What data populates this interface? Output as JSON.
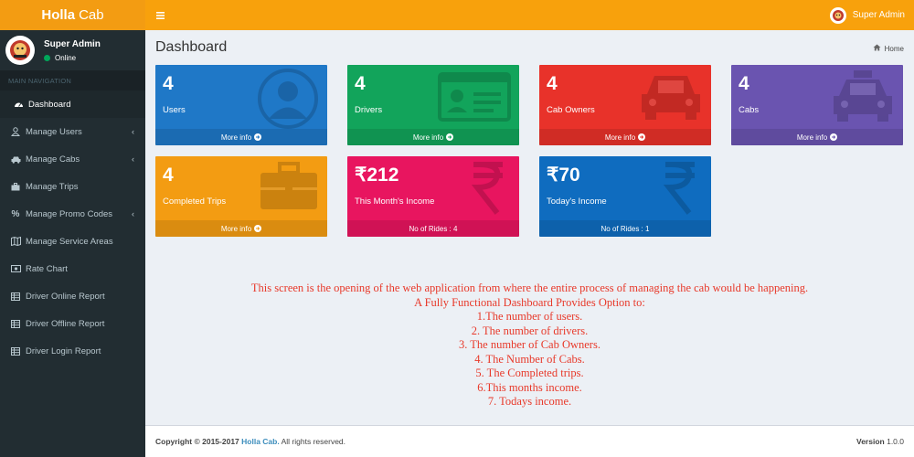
{
  "app": {
    "logo_bold": "Holla",
    "logo_rest": "Cab"
  },
  "topbar": {
    "user_name": "Super Admin"
  },
  "sidebar": {
    "user": {
      "name": "Super Admin",
      "status": "Online"
    },
    "header": "MAIN NAVIGATION",
    "items": [
      {
        "label": "Dashboard",
        "icon": "dashboard-icon"
      },
      {
        "label": "Manage Users",
        "icon": "user-icon",
        "chevron": "‹"
      },
      {
        "label": "Manage Cabs",
        "icon": "car-icon",
        "chevron": "‹"
      },
      {
        "label": "Manage Trips",
        "icon": "briefcase-icon"
      },
      {
        "label": "Manage Promo Codes",
        "icon": "percent-icon",
        "chevron": "‹"
      },
      {
        "label": "Manage Service Areas",
        "icon": "map-icon"
      },
      {
        "label": "Rate Chart",
        "icon": "money-icon"
      },
      {
        "label": "Driver Online Report",
        "icon": "table-icon"
      },
      {
        "label": "Driver Offline Report",
        "icon": "table-icon"
      },
      {
        "label": "Driver Login Report",
        "icon": "table-icon"
      }
    ]
  },
  "page": {
    "title": "Dashboard",
    "breadcrumb": "Home"
  },
  "boxes": [
    {
      "value": "4",
      "label": "Users",
      "footer": "More info"
    },
    {
      "value": "4",
      "label": "Drivers",
      "footer": "More info"
    },
    {
      "value": "4",
      "label": "Cab Owners",
      "footer": "More info"
    },
    {
      "value": "4",
      "label": "Cabs",
      "footer": "More info"
    },
    {
      "value": "4",
      "label": "Completed Trips",
      "footer": "More info"
    },
    {
      "value": "₹212",
      "label": "This Month's Income",
      "footer": "No of Rides : 4"
    },
    {
      "value": "₹70",
      "label": "Today's Income",
      "footer": "No of Rides : 1"
    }
  ],
  "description": [
    "This screen is the opening of the web application from where the entire process of managing the cab would be happening.",
    "A Fully Functional Dashboard Provides Option to:",
    "1.The number of users.",
    "2. The number of drivers.",
    "3. The number of Cab Owners.",
    "4. The Number of Cabs.",
    "5. The Completed trips.",
    "6.This months income.",
    "7. Todays income."
  ],
  "footer": {
    "copyright_prefix": "Copyright © 2015-2017",
    "brand": "Holla Cab.",
    "rights": "All rights reserved.",
    "version_label": "Version",
    "version": "1.0.0"
  }
}
